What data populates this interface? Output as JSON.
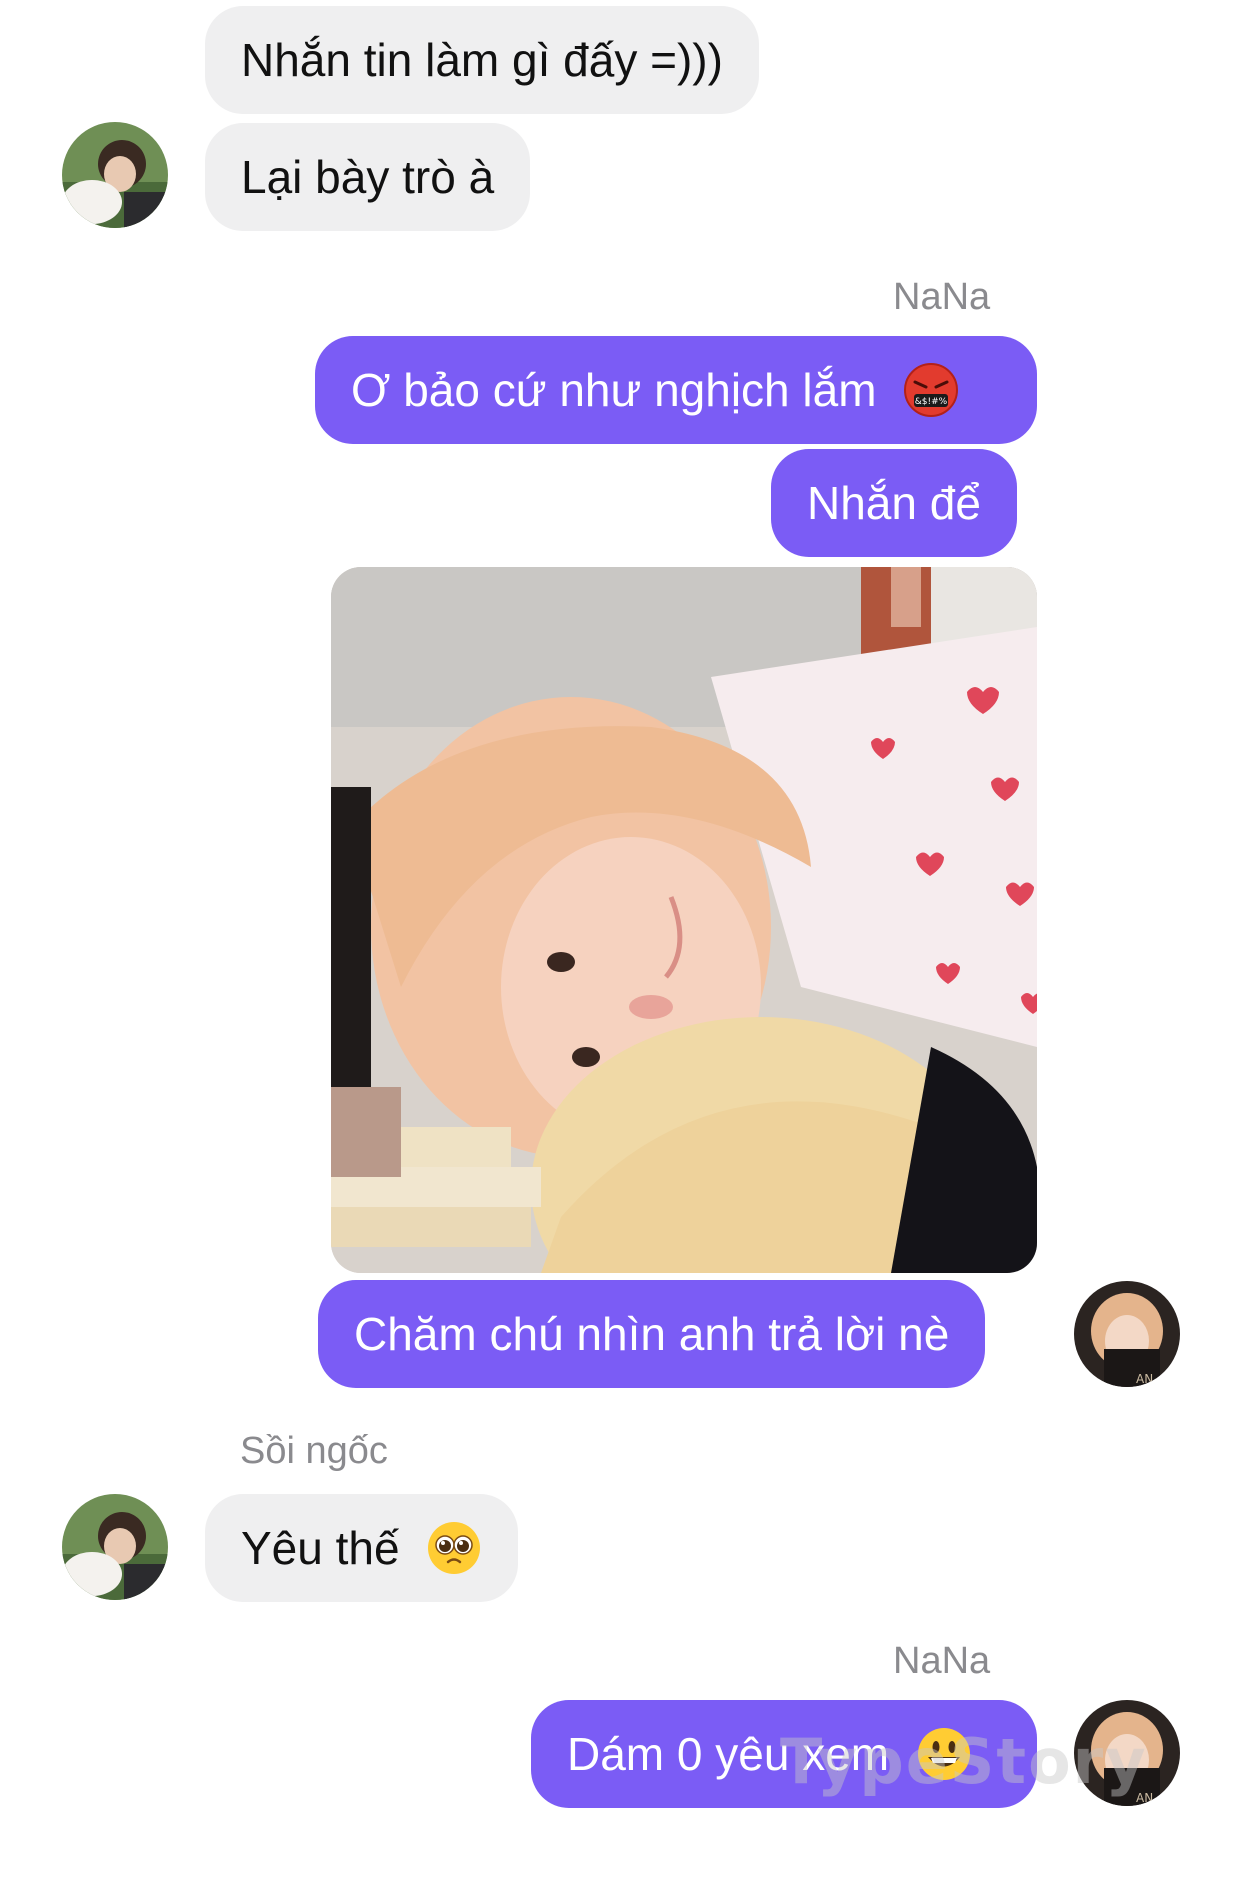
{
  "messages": [
    {
      "side": "in",
      "text": "Nhắn tin làm gì đấy =)))"
    },
    {
      "side": "in",
      "text": "Lại bày trò à"
    },
    {
      "side": "out",
      "sender": "NaNa",
      "text": "Ơ bảo cứ như nghịch lắm",
      "emoji": "cursing-face-emoji"
    },
    {
      "side": "out",
      "text": "Nhắn để"
    },
    {
      "side": "out",
      "image": "photo-attachment"
    },
    {
      "side": "out",
      "text": "Chăm chú nhìn anh trả lời nè"
    },
    {
      "side": "in",
      "sender": "Sồi ngốc",
      "text": "Yêu thế",
      "emoji": "pleading-face-emoji"
    },
    {
      "side": "out",
      "sender": "NaNa",
      "text": "Dám 0 yêu xem",
      "emoji": "grinning-face-emoji"
    }
  ],
  "watermark": "TypeStory",
  "colors": {
    "outgoing_bubble": "#7b5cf5",
    "incoming_bubble": "#efeff0",
    "sender_name": "#8a8a8e"
  }
}
